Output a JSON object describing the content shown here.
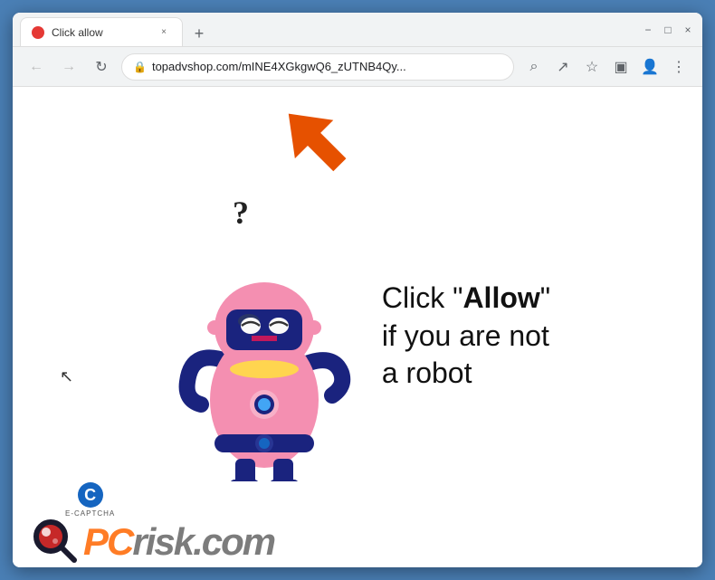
{
  "window": {
    "title": "Click allow",
    "favicon_color": "#e53935",
    "tab_close_label": "×",
    "new_tab_label": "+"
  },
  "window_controls": {
    "minimize": "−",
    "maximize": "□",
    "close": "×"
  },
  "address_bar": {
    "back_label": "←",
    "forward_label": "→",
    "reload_label": "↻",
    "url": "topadvshop.com/mINE4XGkgwQ6_zUTNB4Qy...",
    "lock_symbol": "🔒"
  },
  "toolbar": {
    "search_label": "⌕",
    "share_label": "↗",
    "bookmark_label": "☆",
    "split_label": "▣",
    "profile_label": "👤",
    "menu_label": "⋮"
  },
  "page": {
    "message_line1": "Click \"",
    "message_bold": "Allow",
    "message_line1_end": "\"",
    "message_line2": "if you are not",
    "message_line3": "a robot"
  },
  "watermark": {
    "pc_text": "PC",
    "risk_text": "risk",
    "dot_com": ".com",
    "ecaptcha_c": "C",
    "ecaptcha_label": "E-CAPTCHA"
  },
  "colors": {
    "accent_orange": "#ff6600",
    "robot_pink": "#f06292",
    "robot_dark": "#283593",
    "browser_bg": "#f1f3f4",
    "border": "#ddd"
  }
}
